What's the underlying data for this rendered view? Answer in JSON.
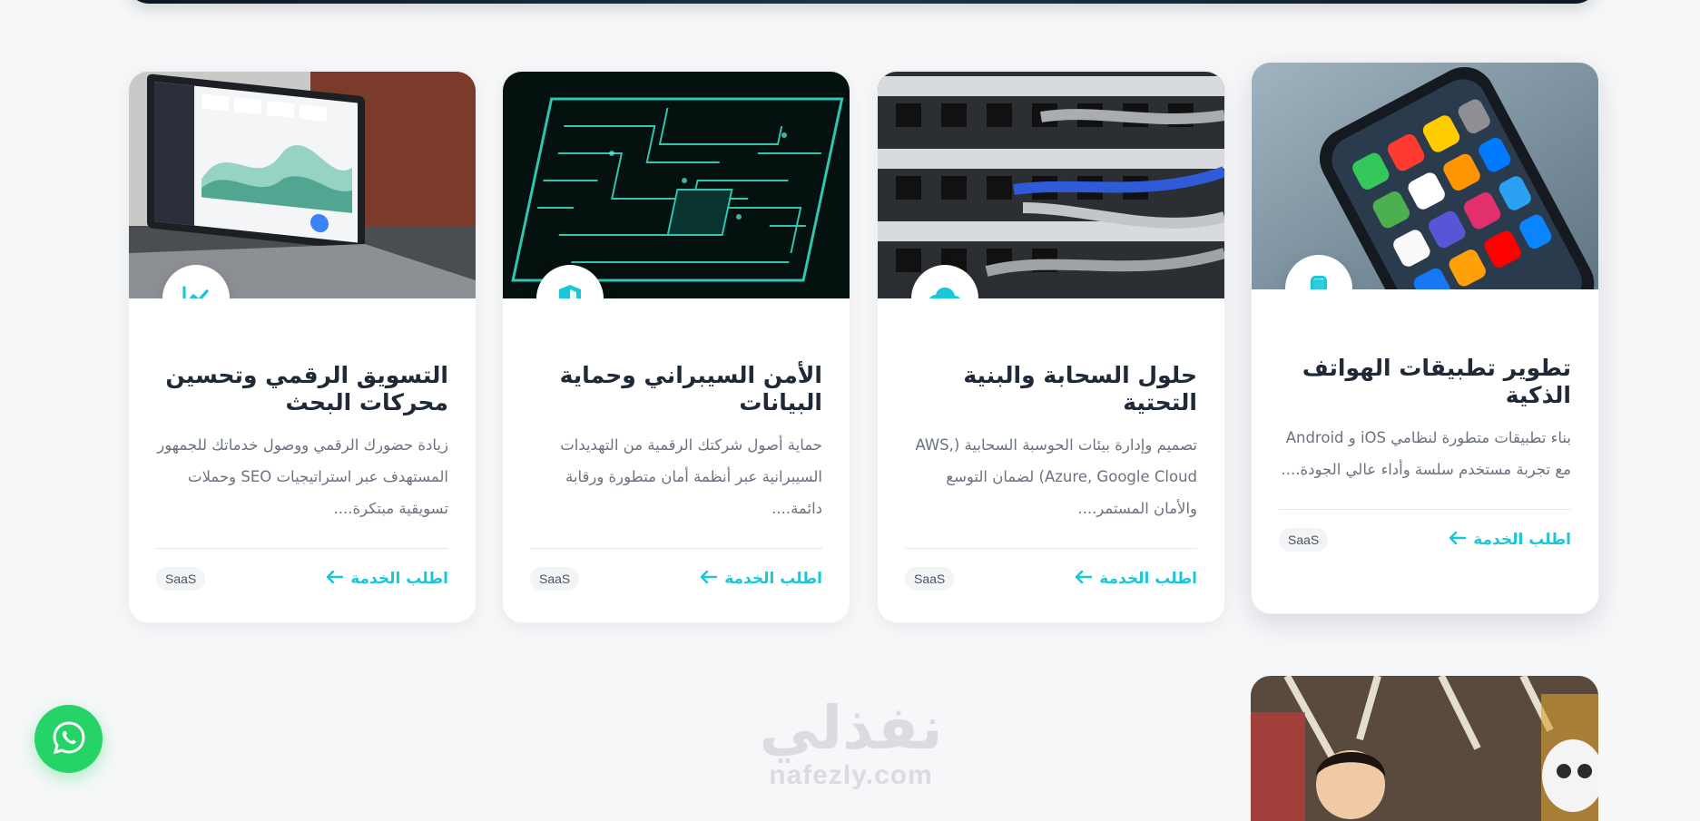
{
  "cards": [
    {
      "title": "تطوير تطبيقات الهواتف الذكية",
      "description": "بناء تطبيقات متطورة لنظامي iOS و Android مع تجربة مستخدم سلسة وأداء عالي الجودة....",
      "cta": "اطلب الخدمة",
      "tag": "SaaS",
      "icon": "smartphone-icon",
      "image": "smartphone-photo"
    },
    {
      "title": "حلول السحابة والبنية التحتية",
      "description": "تصميم وإدارة بيئات الحوسبة السحابية (AWS, Azure, Google Cloud) لضمان التوسع والأمان المستمر....",
      "cta": "اطلب الخدمة",
      "tag": "SaaS",
      "icon": "cloud-icon",
      "image": "server-cables-photo"
    },
    {
      "title": "الأمن السيبراني وحماية البيانات",
      "description": "حماية أصول شركتك الرقمية من التهديدات السيبرانية عبر أنظمة أمان متطورة ورقابة دائمة....",
      "cta": "اطلب الخدمة",
      "tag": "SaaS",
      "icon": "shield-icon",
      "image": "circuit-board-photo"
    },
    {
      "title": "التسويق الرقمي وتحسين محركات البحث",
      "description": "زيادة حضورك الرقمي ووصول خدماتك للجمهور المستهدف عبر استراتيجيات SEO وحملات تسويقية مبتكرة....",
      "cta": "اطلب الخدمة",
      "tag": "SaaS",
      "icon": "chart-line-icon",
      "image": "laptop-dashboard-photo"
    }
  ],
  "watermark": {
    "arabic": "نفذلي",
    "latin": "nafezly.com"
  },
  "floating": {
    "whatsapp_icon": "whatsapp-icon"
  },
  "colors": {
    "accent": "#19c7d8",
    "whatsapp": "#25d366",
    "background": "#f6f7f9"
  }
}
